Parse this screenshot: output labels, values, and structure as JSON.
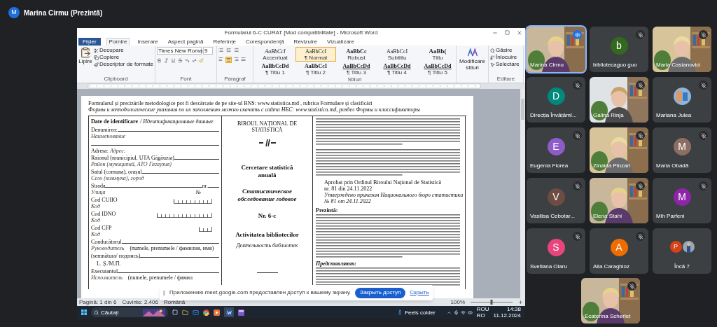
{
  "meet": {
    "presenter_letter": "M",
    "presenter": "Marina Cirmu (Prezintă)"
  },
  "word": {
    "title": "Formularul 6-C CURAT [Mod compatibilitate] - Microsoft Word",
    "file_tab": "Fișier",
    "tabs": [
      {
        "label": "Pornire",
        "selected": true
      },
      {
        "label": "Inserare",
        "selected": false
      },
      {
        "label": "Aspect pagină",
        "selected": false
      },
      {
        "label": "Referințe",
        "selected": false
      },
      {
        "label": "Corespondență",
        "selected": false
      },
      {
        "label": "Revizuire",
        "selected": false
      },
      {
        "label": "Vizualizare",
        "selected": false
      }
    ],
    "clipboard": {
      "paste": "Lipire",
      "items": [
        "Decupare",
        "Copiere",
        "Descriptor de formate"
      ],
      "label": "Clipboard"
    },
    "font": {
      "name": "Times New Roma",
      "size": "9",
      "label": "Font"
    },
    "paragraph": {
      "label": "Paragraf"
    },
    "styles": {
      "label": "Stiluri",
      "items": [
        {
          "sample": "AaBbCcI",
          "name": "Accentuat",
          "kind": "italic",
          "selected": false
        },
        {
          "sample": "AaBbCcI",
          "name": "¶ Normal",
          "kind": "normal",
          "selected": true
        },
        {
          "sample": "AaBbCc",
          "name": "Robust",
          "kind": "bold",
          "selected": false
        },
        {
          "sample": "AaBbCcI",
          "name": "Subtitlu",
          "kind": "normal",
          "selected": false
        },
        {
          "sample": "AaBb(",
          "name": "Titlu",
          "kind": "large",
          "selected": false
        },
        {
          "sample": "AaBbCcDd",
          "name": "¶ Titlu 1",
          "kind": "heading",
          "selected": false
        },
        {
          "sample": "AaBbCcI",
          "name": "¶ Titlu 2",
          "kind": "bold",
          "selected": false
        },
        {
          "sample": "AaBbCcDd",
          "name": "¶ Titlu 3",
          "kind": "underlined",
          "selected": false
        },
        {
          "sample": "AaBbCcDd",
          "name": "¶ Titlu 4",
          "kind": "underlined",
          "selected": false
        },
        {
          "sample": "AaBbCcDd",
          "name": "¶ Titlu 5",
          "kind": "underlined",
          "selected": false
        }
      ]
    },
    "change_styles": "Modificare stiluri",
    "editing": {
      "label": "Editare",
      "items": [
        "Găsire",
        "Înlocuire",
        "Selectare"
      ]
    },
    "document": {
      "header": [
        "Formularul și precizările metodologice pot fi descărcate de pe site-ul BNS: www.statistica.md , rubrica Formulare și clasificări",
        "Формы и методологические указания по их заполнению можно скачать с сайта НБС: www.statistica.md, раздел Формы и классификаторы"
      ],
      "left": [
        {
          "kind": "heading",
          "label": "Date de identificare",
          "hint": "/ Идентификационные данные"
        },
        {
          "kind": "field",
          "label": "Denumirea:",
          "hint": "Наименование"
        },
        {
          "kind": "blank"
        },
        {
          "kind": "inline",
          "label": "Adresa:",
          "hint": "Адрес:"
        },
        {
          "kind": "field",
          "label": "Raionul (municipiul, UTA Găgăuzia)",
          "hint": "Район (муниципий, АТО Гагаузия)"
        },
        {
          "kind": "field",
          "label": "Satul (comuna), orașul",
          "hint": "Село (коммуна), город"
        },
        {
          "kind": "street",
          "label": "Strada",
          "hint": "Улица",
          "nr": "nr.",
          "nr_hint": "№"
        },
        {
          "kind": "code",
          "label": "Cod CUIIO",
          "hint": "Код"
        },
        {
          "kind": "longcode",
          "label": "Cod IDNO",
          "hint": "Код"
        },
        {
          "kind": "shortcode",
          "label": "Cod CFP",
          "hint": "Код"
        },
        {
          "kind": "field",
          "label": "Conducătorul",
          "hint": "Руководитель",
          "note": "(numele, prenumele / фамилия, имя)"
        },
        {
          "kind": "field",
          "label": "(semnătura/ подпись)"
        },
        {
          "kind": "plain",
          "label": "L. Ș./M.П."
        },
        {
          "kind": "field",
          "label": "Executantul",
          "hint": "Исполнитель",
          "note": "(numele, prenumele / фамил"
        }
      ],
      "center": {
        "org": "BIROUL NAȚIONAL DE STATISTICĂ",
        "title": "Cercetare statistică anuală",
        "title_ru": "Статистическое обследование годовое",
        "number": "Nr. 6-c",
        "subject": "Activitatea bibliotecilor",
        "subject_ru": "Деятельность библиотек"
      },
      "right": {
        "approval": [
          "Aprobat prin Ordinul Biroului Național de Statistică",
          "nr. 81 din 24.11.2022",
          "Утверждено приказом Национального бюро статистики",
          "№ 81 от 24.11.2022"
        ],
        "present": "Prezintă:",
        "present_ru": "Представляют:"
      }
    },
    "status": {
      "page": "Pagină: 1 din 6",
      "words": "Cuvinte: 2.406",
      "language": "Română",
      "zoom": "100%",
      "level": 0.5
    }
  },
  "taskbar": {
    "search": "Căutați",
    "weather": "Feels colder",
    "lang_top": "ROU",
    "lang_bottom": "RO",
    "time": "14:38",
    "date": "11.12.2024"
  },
  "toast": {
    "message": "Приложению meet.google.com предоставлен доступ к вашему экрану.",
    "stop_button": "Закрыть доступ",
    "hide_link": "Скрыть"
  },
  "participants": [
    {
      "name": "Marina Cirmu",
      "kind": "video",
      "muted": false,
      "speaking": true
    },
    {
      "name": "bibliotecaguo guo",
      "kind": "avatar",
      "letter": "b",
      "color": "#33691e",
      "muted": true,
      "speaking": false
    },
    {
      "name": "Maria Casianovici",
      "kind": "video",
      "muted": true,
      "speaking": false
    },
    {
      "name": "Direcția Învățămî...",
      "kind": "avatar",
      "letter": "D",
      "color": "#00897b",
      "muted": true,
      "speaking": false
    },
    {
      "name": "Galina Rinja",
      "kind": "video",
      "muted": true,
      "speaking": false
    },
    {
      "name": "Mariana Julea",
      "muted": true,
      "speaking": false
    },
    {
      "name": "Eugenia Florea",
      "kind": "avatar",
      "letter": "E",
      "color": "#8e5cc9",
      "muted": true,
      "speaking": false
    },
    {
      "name": "Zinaida Pinzari",
      "kind": "video",
      "muted": true,
      "speaking": false
    },
    {
      "name": "Maria Obadă",
      "kind": "avatar",
      "letter": "M",
      "color": "#8d6e63",
      "muted": true,
      "speaking": false
    },
    {
      "name": "Vasilisa Cebotar...",
      "kind": "avatar",
      "letter": "V",
      "color": "#6d4c41",
      "muted": true,
      "speaking": false
    },
    {
      "name": "Elena Stahi",
      "kind": "video",
      "muted": true,
      "speaking": false
    },
    {
      "name": "Mih Parfeni",
      "kind": "avatar",
      "letter": "M",
      "color": "#8e24aa",
      "muted": true,
      "speaking": false
    },
    {
      "name": "Svetlana Olaru",
      "kind": "avatar",
      "letter": "S",
      "color": "#e8457c",
      "muted": true,
      "speaking": false
    },
    {
      "name": "Alla Caraghioz",
      "kind": "avatar",
      "letter": "A",
      "color": "#ef6c00",
      "muted": true,
      "speaking": false
    },
    {
      "name": "Încă 7",
      "kind": "more",
      "letter": "P",
      "color": "#d84315",
      "muted": false,
      "speaking": false
    },
    {
      "name": "Ecaterina Scherlet",
      "kind": "video",
      "muted": true,
      "speaking": false
    }
  ]
}
